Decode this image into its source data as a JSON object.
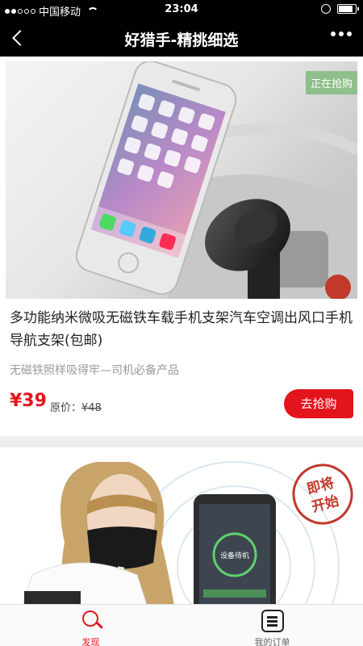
{
  "status_bar": {
    "carrier": "中国移动",
    "time": "23:04",
    "battery_level": 0.85
  },
  "nav": {
    "title": "好猎手-精挑细选"
  },
  "products": [
    {
      "badge": "正在抢购",
      "title": "多功能纳米微吸无磁铁车载手机支架汽车空调出风口手机导航支架(包邮)",
      "subtitle": "无磁铁照样吸得牢—司机必备产品",
      "price": "¥39",
      "original_label": "原价：",
      "original_price": "¥48",
      "buy_label": "去抢购"
    },
    {
      "stamp": [
        "即将",
        "开始"
      ],
      "phone_screen_text": "设备待机"
    }
  ],
  "tabbar": {
    "discover_label": "发现",
    "orders_label": "我的订单"
  },
  "colors": {
    "accent": "#e4141c",
    "badge": "#8fbf8a"
  }
}
